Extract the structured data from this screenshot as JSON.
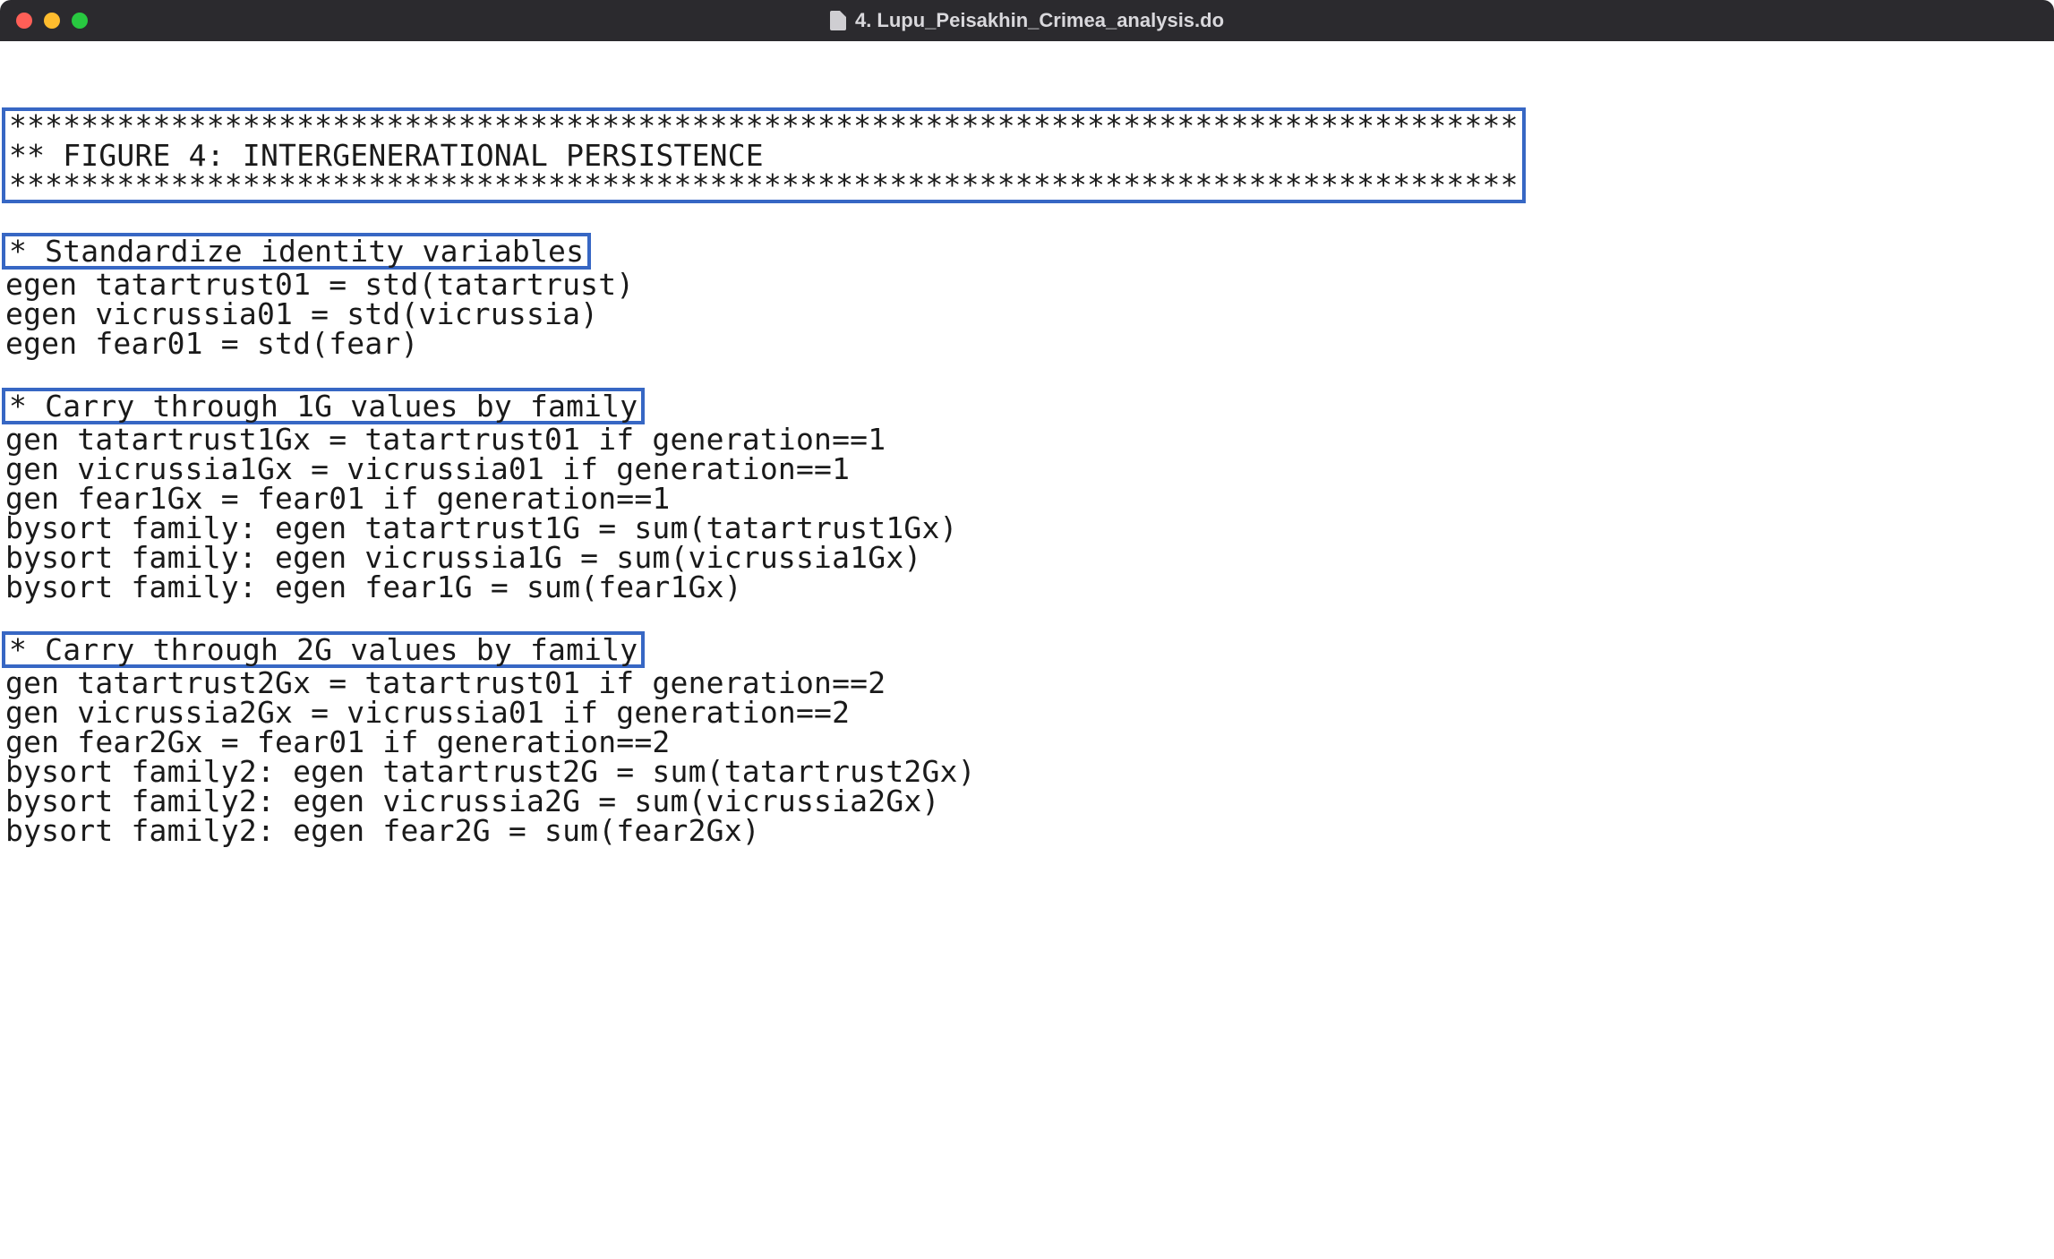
{
  "window": {
    "title": "4. Lupu_Peisakhin_Crimea_analysis.do"
  },
  "code": {
    "box1": {
      "line1": "************************************************************************************",
      "line2": "** FIGURE 4: INTERGENERATIONAL PERSISTENCE",
      "line3": "************************************************************************************"
    },
    "box2": {
      "line1": "* Standardize identity variables"
    },
    "block1": {
      "l1": "egen tatartrust01 = std(tatartrust)",
      "l2": "egen vicrussia01 = std(vicrussia)",
      "l3": "egen fear01 = std(fear)"
    },
    "box3": {
      "line1": "* Carry through 1G values by family"
    },
    "block2": {
      "l1": "gen tatartrust1Gx = tatartrust01 if generation==1",
      "l2": "gen vicrussia1Gx = vicrussia01 if generation==1",
      "l3": "gen fear1Gx = fear01 if generation==1",
      "l4": "bysort family: egen tatartrust1G = sum(tatartrust1Gx)",
      "l5": "bysort family: egen vicrussia1G = sum(vicrussia1Gx)",
      "l6": "bysort family: egen fear1G = sum(fear1Gx)"
    },
    "box4": {
      "line1": "* Carry through 2G values by family"
    },
    "block3": {
      "l1": "gen tatartrust2Gx = tatartrust01 if generation==2",
      "l2": "gen vicrussia2Gx = vicrussia01 if generation==2",
      "l3": "gen fear2Gx = fear01 if generation==2",
      "l4": "bysort family2: egen tatartrust2G = sum(tatartrust2Gx)",
      "l5": "bysort family2: egen vicrussia2G = sum(vicrussia2Gx)",
      "l6": "bysort family2: egen fear2G = sum(fear2Gx)"
    }
  }
}
